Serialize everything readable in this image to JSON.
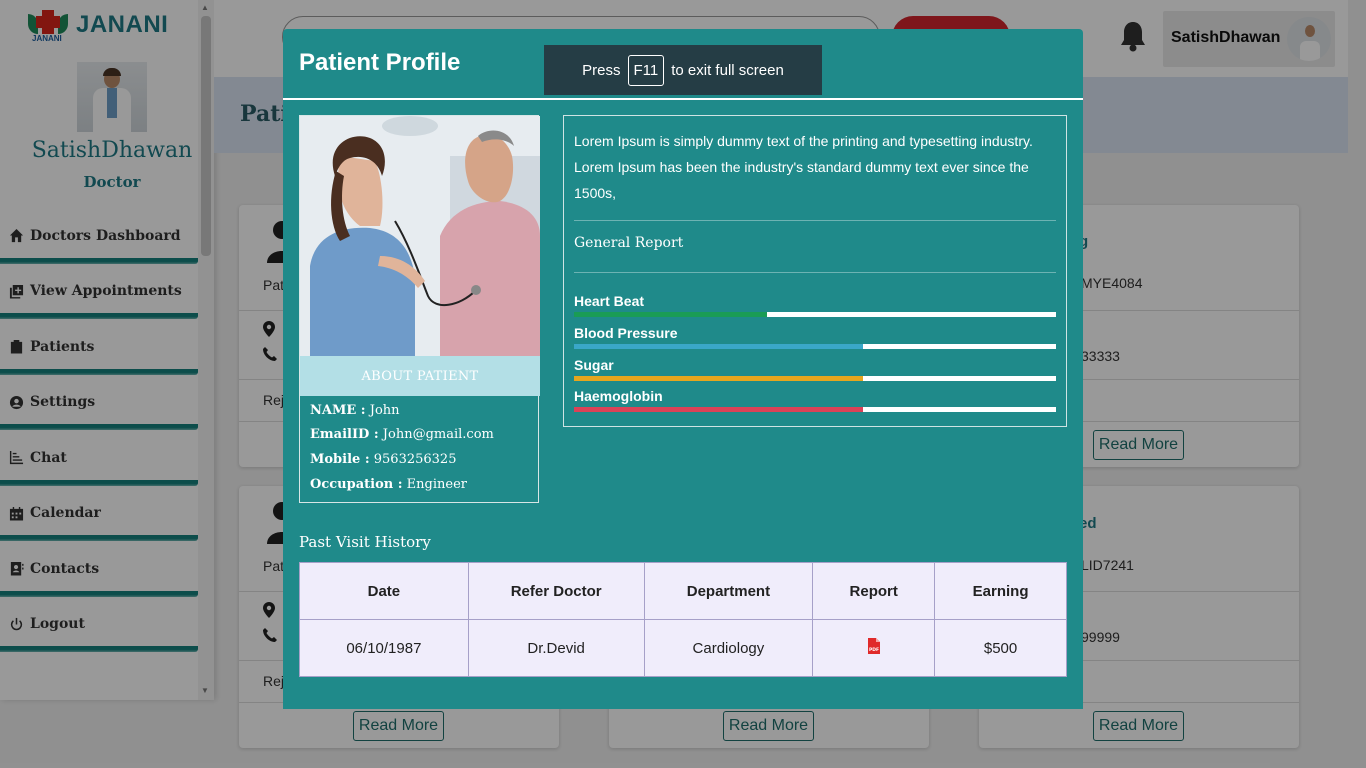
{
  "brand": {
    "name": "JANANI",
    "sub": "JANANI"
  },
  "sidebar": {
    "user_name": "SatishDhawan",
    "user_role": "Doctor",
    "items": [
      {
        "label": "Doctors Dashboard",
        "icon": "home-icon"
      },
      {
        "label": "View Appointments",
        "icon": "appointments-icon"
      },
      {
        "label": "Patients",
        "icon": "clipboard-icon"
      },
      {
        "label": "Settings",
        "icon": "user-circle-icon"
      },
      {
        "label": "Chat",
        "icon": "chart-icon"
      },
      {
        "label": "Calendar",
        "icon": "calendar-icon"
      },
      {
        "label": "Contacts",
        "icon": "contacts-icon"
      },
      {
        "label": "Logout",
        "icon": "power-icon"
      }
    ]
  },
  "topbar": {
    "user_name": "SatishDhawan"
  },
  "banner": {
    "title": "Pati"
  },
  "cards": {
    "read_more": "Read More",
    "c1": {
      "pat": "Pat",
      "rej": "Rej"
    },
    "c3": {
      "title": "g",
      "id": "MYE4084",
      "phone": "33333"
    },
    "c4": {
      "pat": "Pat",
      "rej": "Rej"
    },
    "c6": {
      "title": "ed",
      "id": "LID7241",
      "phone": "99999"
    }
  },
  "modal": {
    "title": "Patient Profile",
    "fullscreen_toast": {
      "press": "Press",
      "key": "F11",
      "suffix": "to exit full screen"
    },
    "about": {
      "heading": "ABOUT PATIENT",
      "name_label": "NAME :",
      "name": "John",
      "email_label": "EmailID :",
      "email": "John@gmail.com",
      "mobile_label": "Mobile :",
      "mobile": "9563256325",
      "occupation_label": "Occupation :",
      "occupation": "Engineer"
    },
    "description": "Lorem Ipsum is simply dummy text of the printing and typesetting industry. Lorem Ipsum has been the industry's standard dummy text ever since the 1500s,",
    "general_report": "General Report",
    "metrics": [
      {
        "label": "Heart Beat",
        "percent": 40,
        "color": "#1a9c55"
      },
      {
        "label": "Blood Pressure",
        "percent": 60,
        "color": "#3aa7c8"
      },
      {
        "label": "Sugar",
        "percent": 60,
        "color": "#e6a61e"
      },
      {
        "label": "Haemoglobin",
        "percent": 60,
        "color": "#db4257"
      }
    ],
    "past_visit_title": "Past Visit History",
    "history": {
      "headers": [
        "Date",
        "Refer Doctor",
        "Department",
        "Report",
        "Earning"
      ],
      "rows": [
        {
          "date": "06/10/1987",
          "doctor": "Dr.Devid",
          "department": "Cardiology",
          "report_icon": "pdf-icon",
          "earning": "$500"
        }
      ]
    }
  }
}
